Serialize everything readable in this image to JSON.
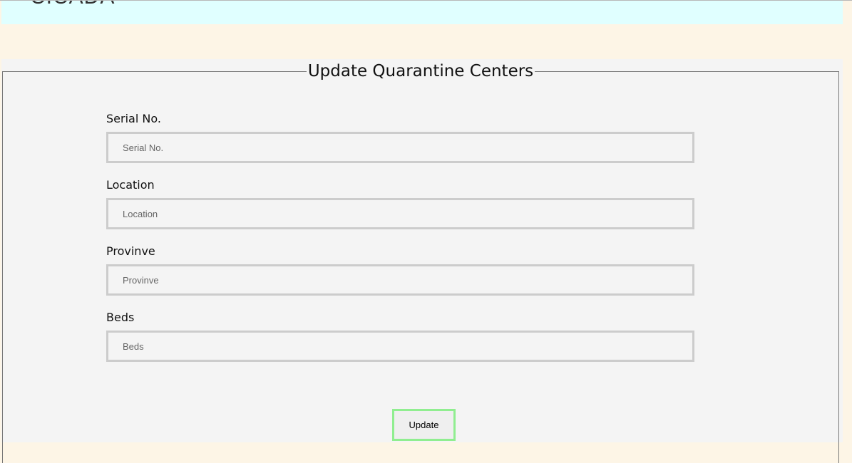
{
  "header": {
    "logo": "CICADA"
  },
  "form": {
    "title": "Update Quarantine Centers",
    "fields": [
      {
        "label": "Serial No.",
        "placeholder": "Serial No.",
        "value": ""
      },
      {
        "label": "Location",
        "placeholder": "Location",
        "value": ""
      },
      {
        "label": "Provinve",
        "placeholder": "Provinve",
        "value": ""
      },
      {
        "label": "Beds",
        "placeholder": "Beds",
        "value": ""
      }
    ],
    "submit_label": "Update"
  }
}
